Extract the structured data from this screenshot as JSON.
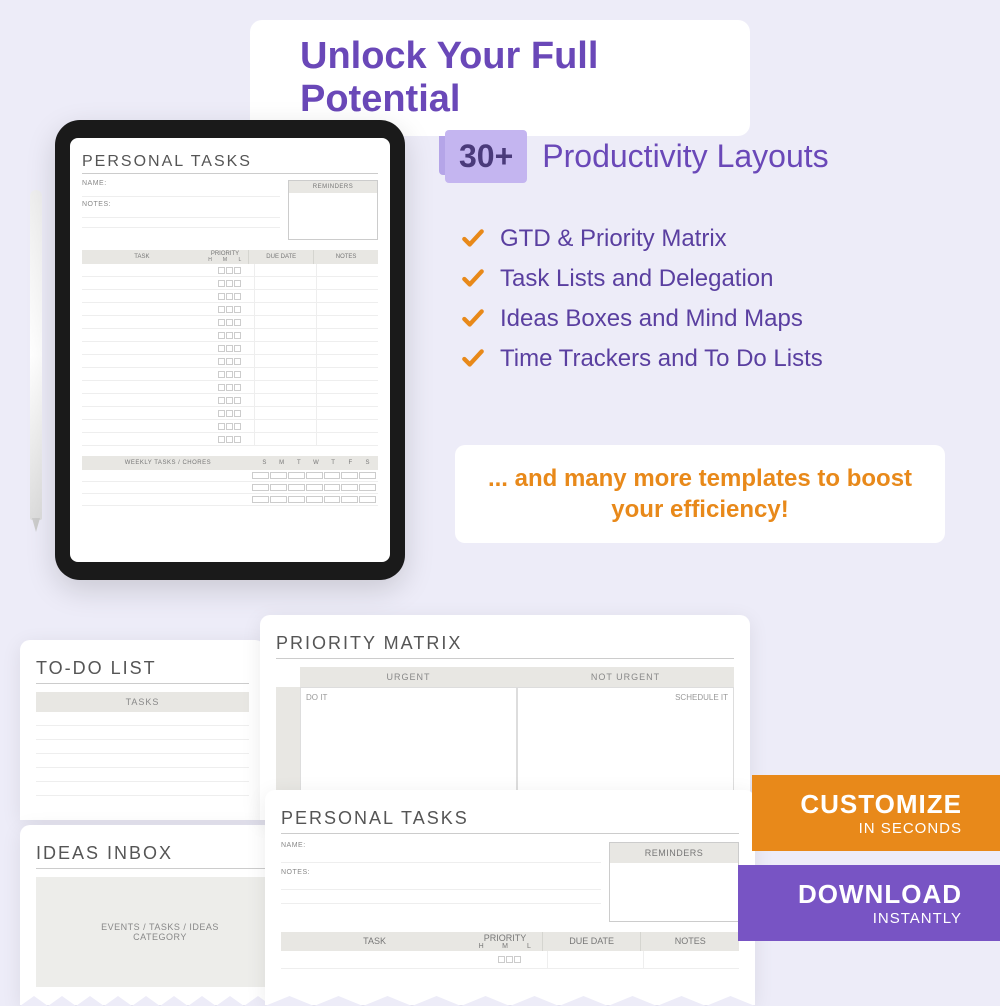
{
  "title": "Unlock Your Full Potential",
  "badge": "30+",
  "subtitle": "Productivity Layouts",
  "features": [
    "GTD & Priority Matrix",
    "Task Lists and Delegation",
    "Ideas Boxes and Mind Maps",
    "Time Trackers and To Do Lists"
  ],
  "more_text": "... and many more templates to boost your efficiency!",
  "cta": {
    "customize": {
      "main": "CUSTOMIZE",
      "sub": "IN SECONDS"
    },
    "download": {
      "main": "DOWNLOAD",
      "sub": "INSTANTLY"
    }
  },
  "tablet": {
    "title": "PERSONAL TASKS",
    "name_label": "NAME:",
    "notes_label": "NOTES:",
    "reminders": "REMINDERS",
    "cols": {
      "task": "TASK",
      "priority": "PRIORITY",
      "h": "H",
      "m": "M",
      "l": "L",
      "due": "DUE DATE",
      "notes": "NOTES"
    },
    "weekly": "WEEKLY TASKS / CHORES",
    "days": [
      "S",
      "M",
      "T",
      "W",
      "T",
      "F",
      "S"
    ]
  },
  "cards": {
    "todo": {
      "title": "TO-DO LIST",
      "col": "TASKS"
    },
    "ideas": {
      "title": "IDEAS INBOX",
      "line1": "EVENTS / TASKS / IDEAS",
      "line2": "CATEGORY"
    },
    "matrix": {
      "title": "PRIORITY MATRIX",
      "urgent": "URGENT",
      "not_urgent": "NOT URGENT",
      "doit": "DO IT",
      "schedule": "SCHEDULE IT"
    },
    "personal": {
      "title": "PERSONAL TASKS"
    }
  }
}
